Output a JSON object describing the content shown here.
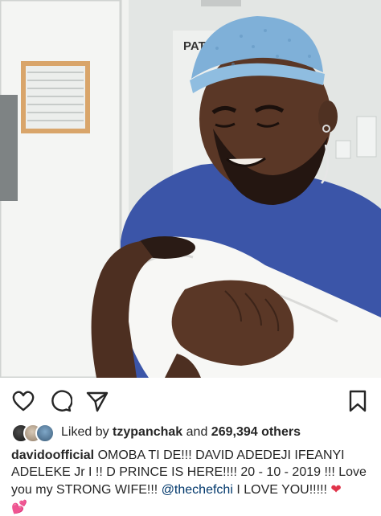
{
  "post": {
    "photo_label": "PATSH",
    "actions": {
      "like_icon": "heart-icon",
      "comment_icon": "comment-icon",
      "share_icon": "send-icon",
      "save_icon": "bookmark-icon"
    },
    "likes": {
      "prefix": "Liked by",
      "user": "tzypanchak",
      "connector": "and",
      "count": "269,394 others"
    },
    "caption": {
      "username": "davidoofficial",
      "text_part1": "OMOBA TI DE!!! DAVID ADEDEJI IFEANYI ADELEKE Jr I !! D PRINCE IS HERE!!!! 20 - 10 - 2019 !!! Love you my STRONG WIFE!!!",
      "mention": "@thechefchi",
      "text_part2": "I LOVE YOU!!!!!",
      "emoji_heart": "❤",
      "emoji_hearts": "💕"
    },
    "colors": {
      "text": "#262626",
      "mention": "#00376b",
      "scrubs": "#3b55a8",
      "cap": "#7fb0d8"
    }
  }
}
